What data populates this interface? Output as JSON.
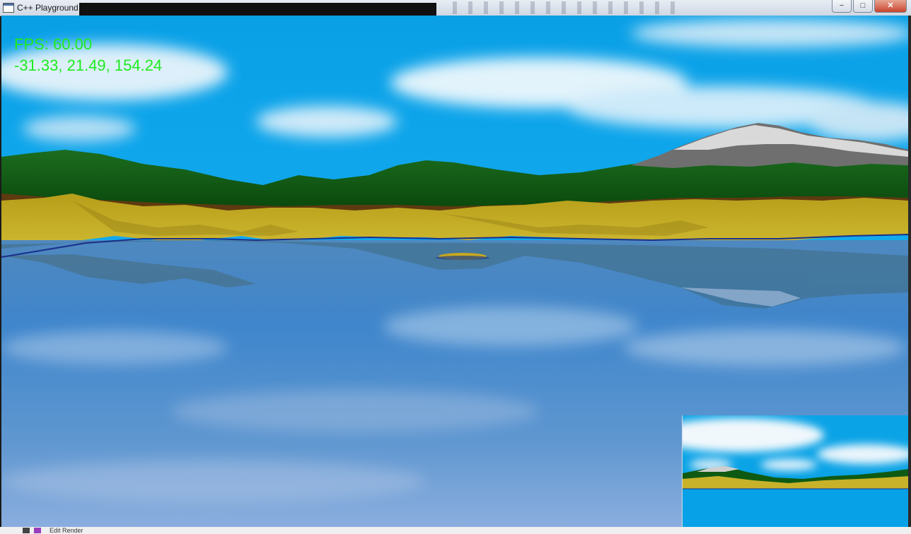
{
  "window": {
    "title": "C++ Playground",
    "minimize_label": "−",
    "maximize_label": "□",
    "close_label": "✕"
  },
  "hud": {
    "fps": "FPS: 60.00",
    "position": "-31.33, 21.49, 154.24"
  },
  "bottom": {
    "fragment": "Edit Render"
  },
  "colors": {
    "sky": "#0ea5e9",
    "hud_text": "#1eeb1e",
    "water": "#4b86c6",
    "grass": "#0f5a12",
    "sand": "#c8b22a",
    "snow": "#d8d8d8"
  },
  "icons": [
    "app-window-icon",
    "minimize-icon",
    "maximize-icon",
    "close-icon"
  ]
}
